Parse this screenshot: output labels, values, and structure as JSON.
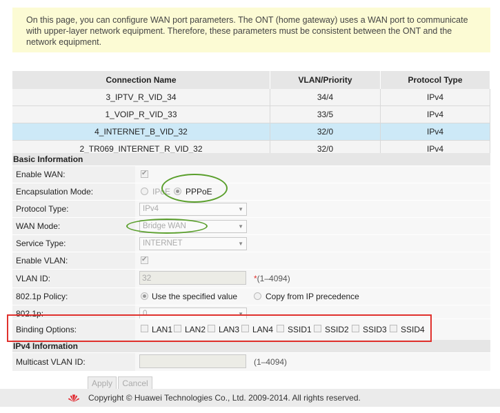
{
  "notice": "On this page, you can configure WAN port parameters. The ONT (home gateway) uses a WAN port to communicate with upper-layer network equipment. Therefore, these parameters must be consistent between the ONT and the network equipment.",
  "table": {
    "headers": [
      "Connection Name",
      "VLAN/Priority",
      "Protocol Type"
    ],
    "rows": [
      [
        "3_IPTV_R_VID_34",
        "34/4",
        "IPv4"
      ],
      [
        "1_VOIP_R_VID_33",
        "33/5",
        "IPv4"
      ],
      [
        "4_INTERNET_B_VID_32",
        "32/0",
        "IPv4"
      ],
      [
        "2_TR069_INTERNET_R_VID_32",
        "32/0",
        "IPv4"
      ]
    ],
    "selected_row": 2
  },
  "basic": {
    "title": "Basic Information",
    "enable_wan_label": "Enable WAN:",
    "encap_label": "Encapsulation Mode:",
    "encap_opt1": "IPoE",
    "encap_opt2": "PPPoE",
    "protocol_label": "Protocol Type:",
    "protocol_value": "IPv4",
    "wan_mode_label": "WAN Mode:",
    "wan_mode_value": "Bridge WAN",
    "service_label": "Service Type:",
    "service_value": "INTERNET",
    "enable_vlan_label": "Enable VLAN:",
    "vlan_id_label": "VLAN ID:",
    "vlan_id_value": "32",
    "vlan_id_hint": "(1–4094)",
    "policy_label": "802.1p Policy:",
    "policy_opt1": "Use the specified value",
    "policy_opt2": "Copy from IP precedence",
    "p8021_label": "802.1p:",
    "p8021_value": "0",
    "binding_label": "Binding Options:",
    "binding": [
      "LAN1",
      "LAN2",
      "LAN3",
      "LAN4",
      "SSID1",
      "SSID2",
      "SSID3",
      "SSID4"
    ]
  },
  "ipv4": {
    "title": "IPv4 Information",
    "multicast_label": "Multicast VLAN ID:",
    "multicast_hint": "(1–4094)"
  },
  "buttons": {
    "apply": "Apply",
    "cancel": "Cancel"
  },
  "footer": "Copyright © Huawei Technologies Co., Ltd. 2009-2014. All rights reserved.",
  "colors": {
    "selected_row": "#cde9f7",
    "annotation_ellipse": "#5a9f2c",
    "annotation_box": "#e0302c",
    "brand": "#e1262d"
  }
}
